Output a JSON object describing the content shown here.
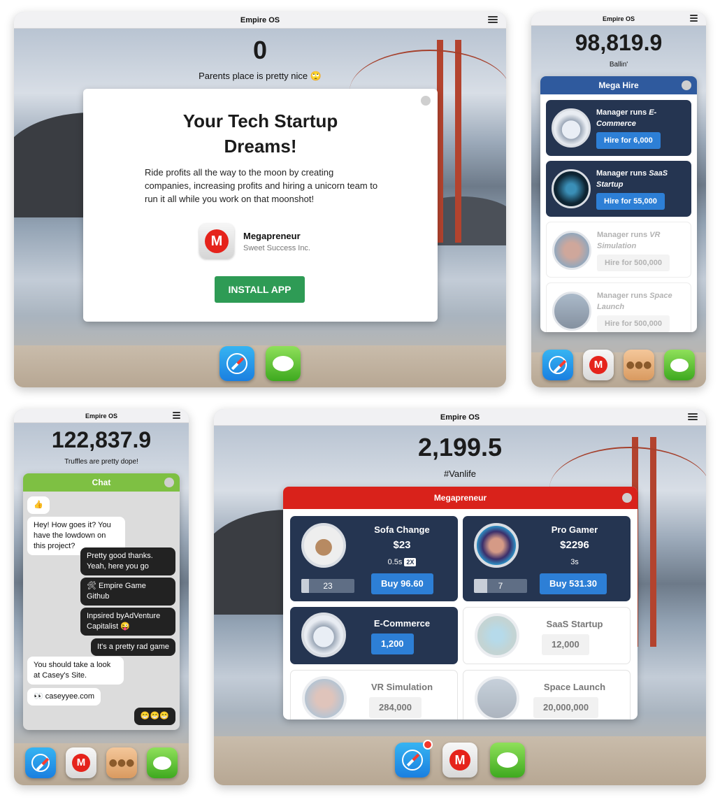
{
  "os_title": "Empire OS",
  "screen1": {
    "score": "0",
    "status": "Parents place is pretty nice 🙄",
    "modal": {
      "title": "Your Tech Startup Dreams!",
      "body": "Ride profits all the way to the moon by creating companies, increasing profits and hiring a unicorn team to run it all while you work on that moonshot!",
      "app_name": "Megapreneur",
      "app_company": "Sweet Success Inc.",
      "app_logo_letter": "M",
      "install_label": "INSTALL APP"
    },
    "dock": [
      "safari-icon",
      "messages-icon"
    ]
  },
  "screen2": {
    "score": "98,819.9",
    "status": "Ballin'",
    "panel_title": "Mega Hire",
    "managers": [
      {
        "prefix": "Manager runs ",
        "name": "E-Commerce",
        "hire": "Hire for 6,000",
        "active": true
      },
      {
        "prefix": "Manager runs ",
        "name": "SaaS Startup",
        "hire": "Hire for 55,000",
        "active": true
      },
      {
        "prefix": "Manager runs ",
        "name": "VR Simulation",
        "hire": "Hire for 500,000",
        "active": false
      },
      {
        "prefix": "Manager runs ",
        "name": "Space Launch",
        "hire": "Hire for 500,000",
        "active": false
      }
    ],
    "dock": [
      "safari-icon",
      "megapreneur-icon",
      "team-icon",
      "messages-icon"
    ]
  },
  "screen3": {
    "score": "122,837.9",
    "status": "Truffles are pretty dope!",
    "panel_title": "Chat",
    "messages": [
      {
        "dir": "in",
        "text": "👍"
      },
      {
        "dir": "in",
        "text": "Hey! How goes it? You have the lowdown on this project?"
      },
      {
        "dir": "out",
        "text": "Pretty good thanks. Yeah, here you go"
      },
      {
        "dir": "out",
        "text": "🛠 Empire Game Github"
      },
      {
        "dir": "out",
        "text": "Inpsired byAdVenture Capitalist 😜"
      },
      {
        "dir": "out",
        "text": "It's a pretty rad game"
      },
      {
        "dir": "in",
        "text": "You should take a look at Casey's Site."
      },
      {
        "dir": "in",
        "text": "👀 caseyyee.com"
      },
      {
        "dir": "out",
        "text": "😁😁😁"
      }
    ],
    "dock": [
      "safari-icon",
      "megapreneur-icon",
      "team-icon",
      "messages-icon"
    ]
  },
  "screen4": {
    "score": "2,199.5",
    "status": "#Vanlife",
    "panel_title": "Megapreneur",
    "businesses": [
      {
        "name": "Sofa Change",
        "price": "$23",
        "time": "0.5s",
        "badge": "2X",
        "owned": "23",
        "progress": 0.15,
        "buy": "Buy 96.60",
        "active": true
      },
      {
        "name": "Pro Gamer",
        "price": "$2296",
        "time": "3s",
        "badge": "",
        "owned": "7",
        "progress": 0.25,
        "buy": "Buy 531.30",
        "active": true
      },
      {
        "name": "E-Commerce",
        "price": "",
        "time": "",
        "badge": "",
        "owned": "",
        "progress": 0,
        "buy": "1,200",
        "active": true
      },
      {
        "name": "SaaS Startup",
        "price": "",
        "time": "",
        "badge": "",
        "owned": "",
        "progress": 0,
        "buy": "12,000",
        "active": false
      },
      {
        "name": "VR Simulation",
        "price": "",
        "time": "",
        "badge": "",
        "owned": "",
        "progress": 0,
        "buy": "284,000",
        "active": false
      },
      {
        "name": "Space Launch",
        "price": "",
        "time": "",
        "badge": "",
        "owned": "",
        "progress": 0,
        "buy": "20,000,000",
        "active": false
      }
    ],
    "dock": [
      "safari-icon",
      "megapreneur-icon",
      "messages-icon"
    ]
  },
  "colors": {
    "mega_hire_header": "#2f5a9e",
    "chat_header": "#7ec043",
    "megapreneur_header": "#d9221b",
    "card_active": "#253551",
    "button_blue": "#2d7fd6",
    "install_green": "#2e9b55"
  }
}
